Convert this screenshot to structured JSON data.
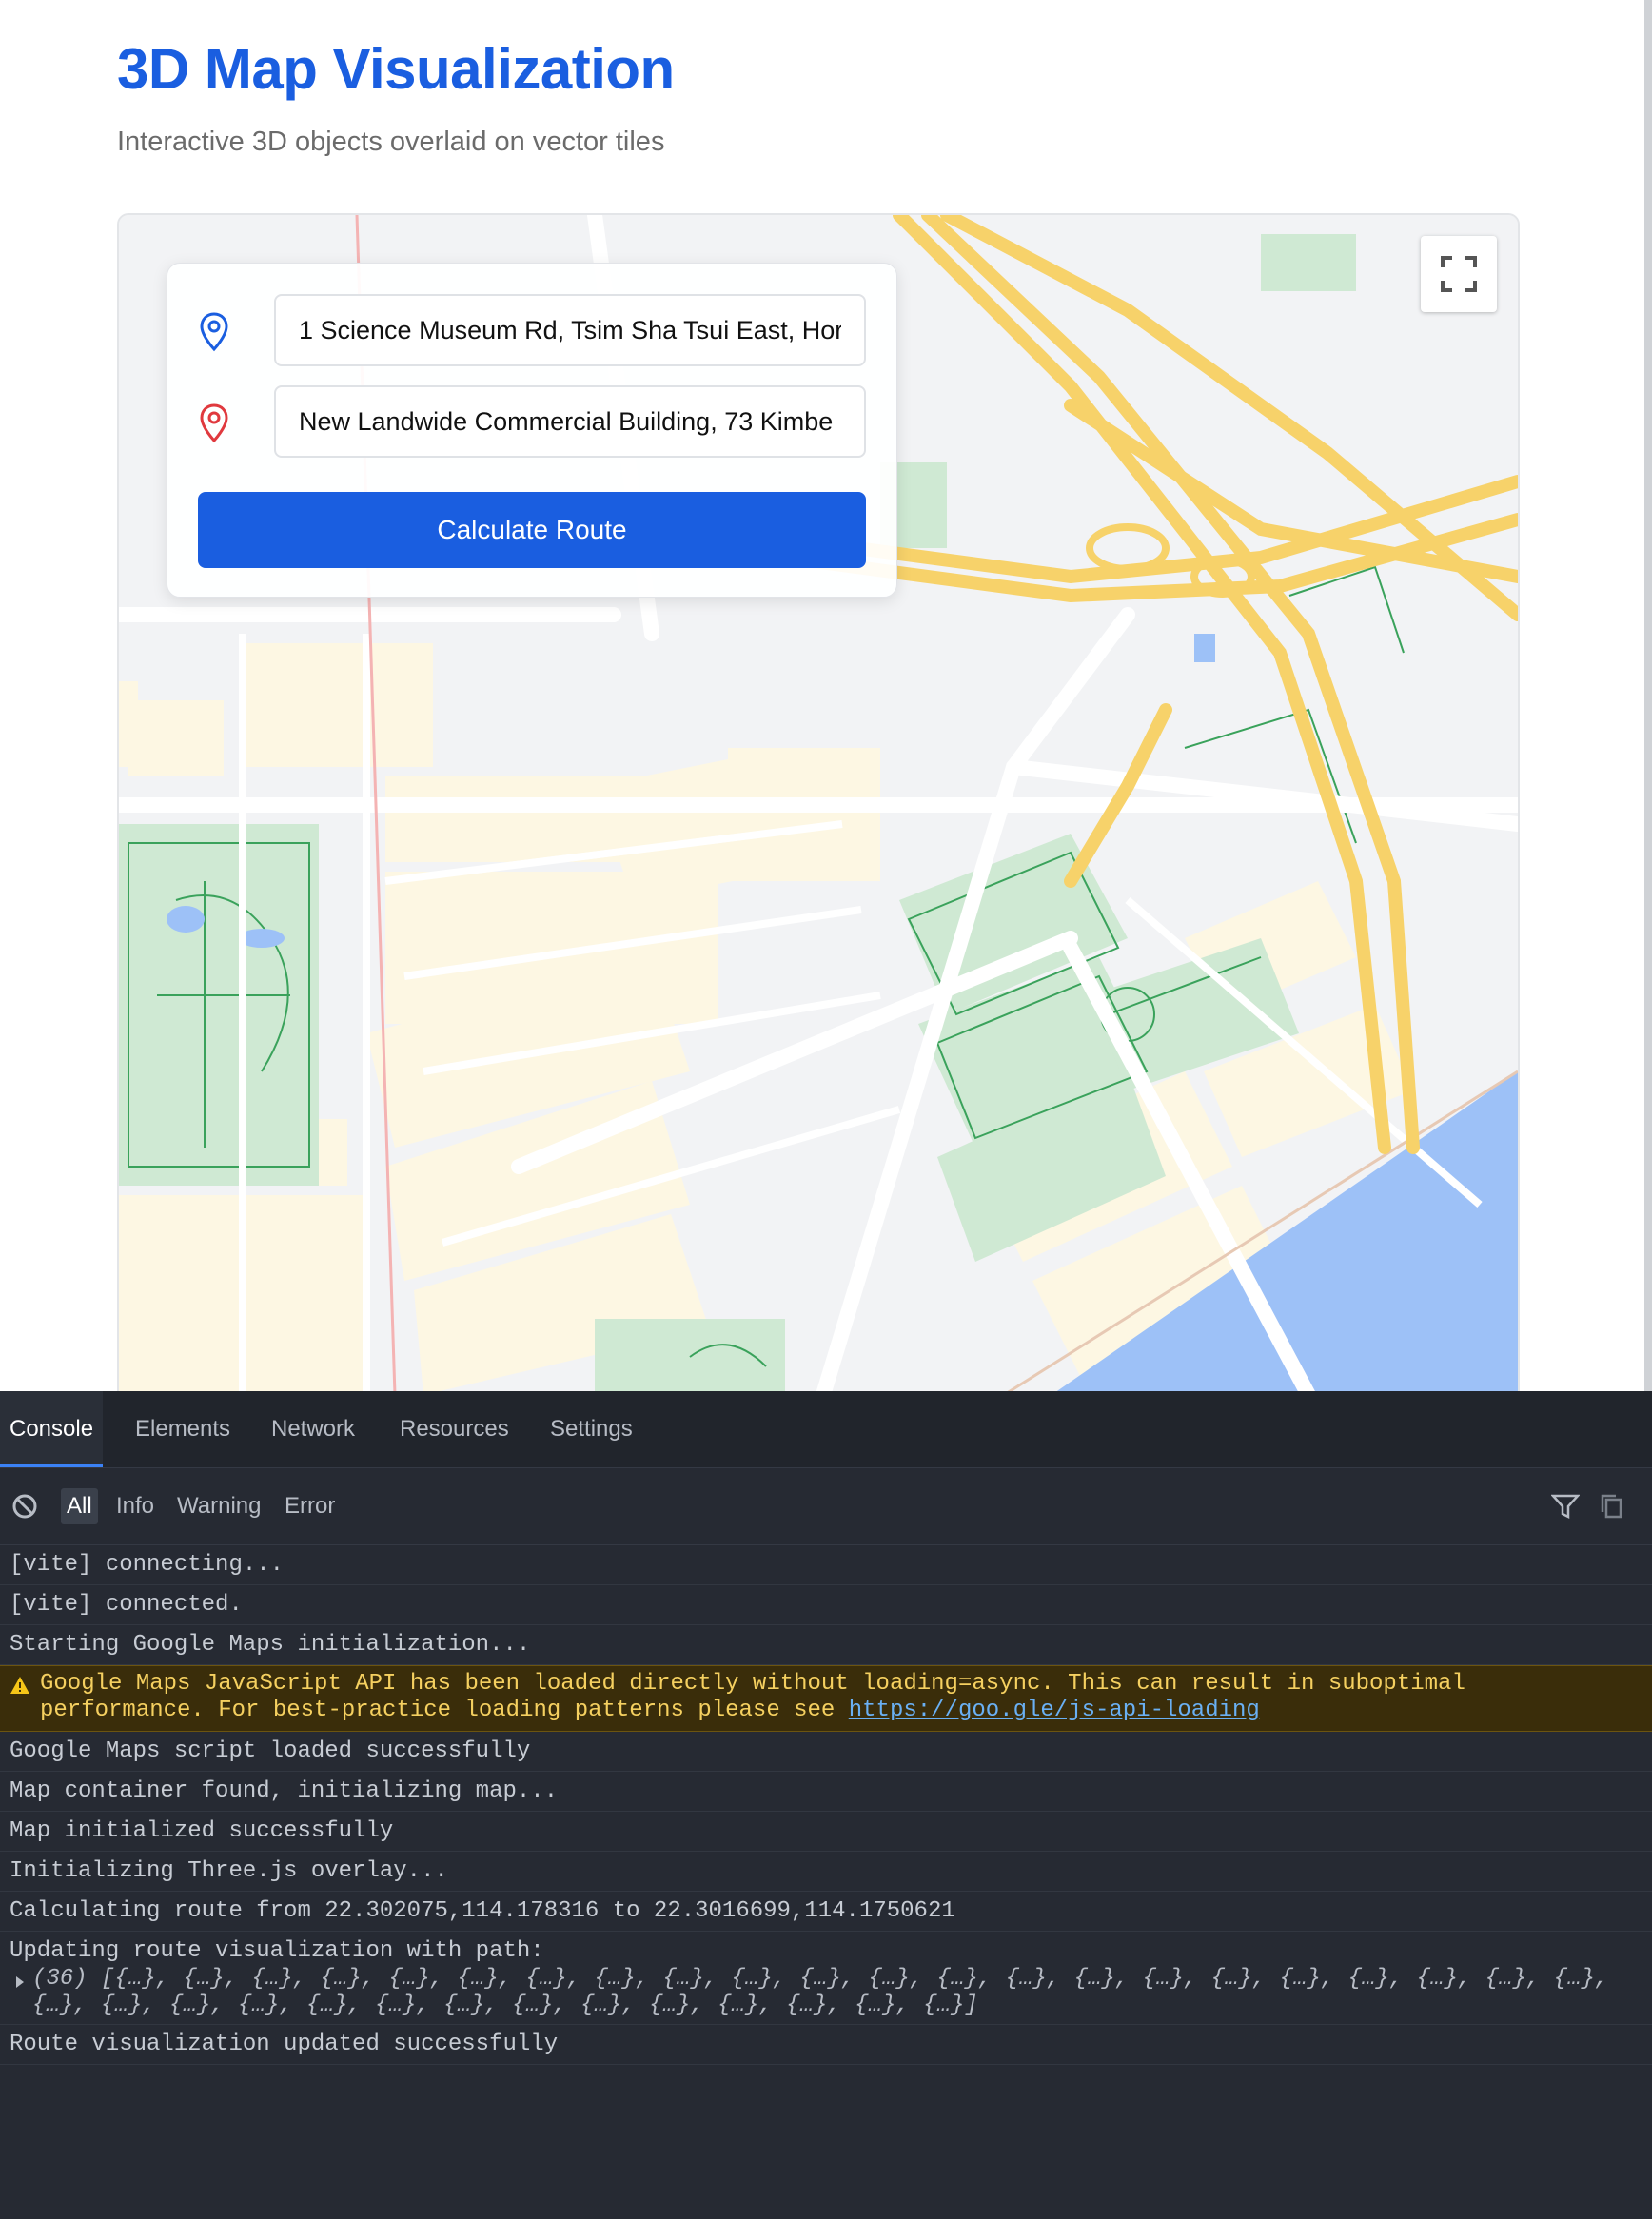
{
  "page": {
    "title": "3D Map Visualization",
    "subtitle": "Interactive 3D objects overlaid on vector tiles"
  },
  "route_panel": {
    "origin_value": "1 Science Museum Rd, Tsim Sha Tsui East, Hor",
    "destination_value": "New Landwide Commercial Building, 73 Kimbe",
    "calculate_label": "Calculate Route"
  },
  "map": {
    "fullscreen_icon": "fullscreen-icon",
    "colors": {
      "highway": "#f7d26a",
      "park": "#cfe9d3",
      "water": "#9dc1f7",
      "building": "#fdf7e3",
      "road": "#ffffff",
      "background": "#f2f3f5"
    }
  },
  "devtools": {
    "tabs": [
      "Console",
      "Elements",
      "Network",
      "Resources",
      "Settings"
    ],
    "active_tab": "Console",
    "filters": [
      "All",
      "Info",
      "Warning",
      "Error"
    ],
    "active_filter": "All",
    "logs": [
      {
        "text": "[vite] connecting..."
      },
      {
        "text": "[vite] connected."
      },
      {
        "text": "Starting Google Maps initialization..."
      },
      {
        "text": "Google Maps JavaScript API has been loaded directly without loading=async. This can result in suboptimal",
        "text2": "performance. For best-practice loading patterns please see ",
        "link": "https://goo.gle/js-api-loading",
        "level": "warning"
      },
      {
        "text": "Google Maps script loaded successfully"
      },
      {
        "text": "Map container found, initializing map..."
      },
      {
        "text": "Map initialized successfully"
      },
      {
        "text": "Initializing Three.js overlay..."
      },
      {
        "text": "Calculating route from 22.302075,114.178316 to 22.3016699,114.1750621"
      },
      {
        "text": "Updating route visualization with path:",
        "text2": "(36) [{…}, {…}, {…}, {…}, {…}, {…}, {…}, {…}, {…}, {…}, {…}, {…}, {…}, {…}, {…}, {…}, {…}, {…}, {…}, {…}, {…}, {…},",
        "text3": "{…}, {…}, {…}, {…}, {…}, {…}, {…}, {…}, {…}, {…}, {…}, {…}, {…}, {…}]"
      },
      {
        "text": "Route visualization updated successfully"
      }
    ],
    "colors": {
      "background": "#262a33",
      "warning_bg": "#3a2d0a",
      "warning_text": "#f5d060",
      "accent": "#3b82f6"
    }
  }
}
